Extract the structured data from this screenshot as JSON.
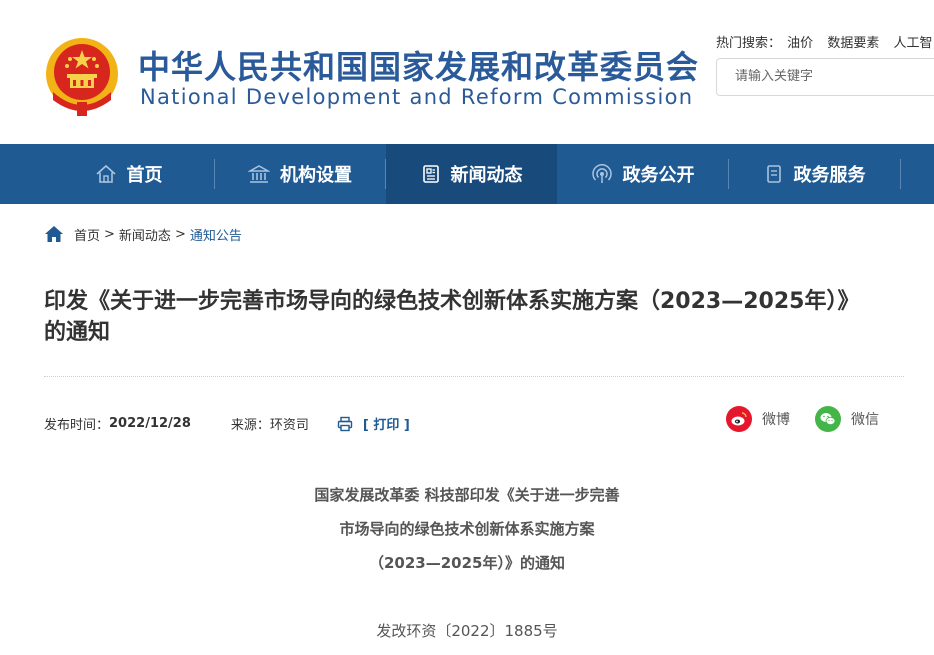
{
  "header": {
    "title_cn": "中华人民共和国国家发展和改革委员会",
    "title_en": "National Development and Reform Commission",
    "hot_label": "热门搜索：",
    "hot_items": [
      "油价",
      "数据要素",
      "人工智"
    ],
    "search_placeholder": "请输入关键字"
  },
  "nav": {
    "items": [
      {
        "label": "首页",
        "icon": "house-icon"
      },
      {
        "label": "机构设置",
        "icon": "building-icon"
      },
      {
        "label": "新闻动态",
        "icon": "news-icon",
        "active": true
      },
      {
        "label": "政务公开",
        "icon": "broadcast-icon"
      },
      {
        "label": "政务服务",
        "icon": "document-icon"
      }
    ]
  },
  "breadcrumb": {
    "home": "首页",
    "sep": ">",
    "section": "新闻动态",
    "current": "通知公告"
  },
  "article": {
    "title": "印发《关于进一步完善市场导向的绿色技术创新体系实施方案（2023—2025年）》的通知",
    "publish_label": "发布时间：",
    "publish_date": "2022/12/28",
    "source_label": "来源：",
    "source": "环资司",
    "print_label": "[ 打印 ]",
    "share_weibo": "微博",
    "share_wechat": "微信",
    "doc_title_lines": [
      "国家发展改革委 科技部印发《关于进一步完善",
      "市场导向的绿色技术创新体系实施方案",
      "（2023—2025年）》的通知"
    ],
    "doc_number": "发改环资〔2022〕1885号"
  },
  "colors": {
    "brand_blue": "#1f5a93",
    "nav_active": "#184a7c",
    "weibo_red": "#e6162d",
    "wechat_green": "#44b549"
  }
}
